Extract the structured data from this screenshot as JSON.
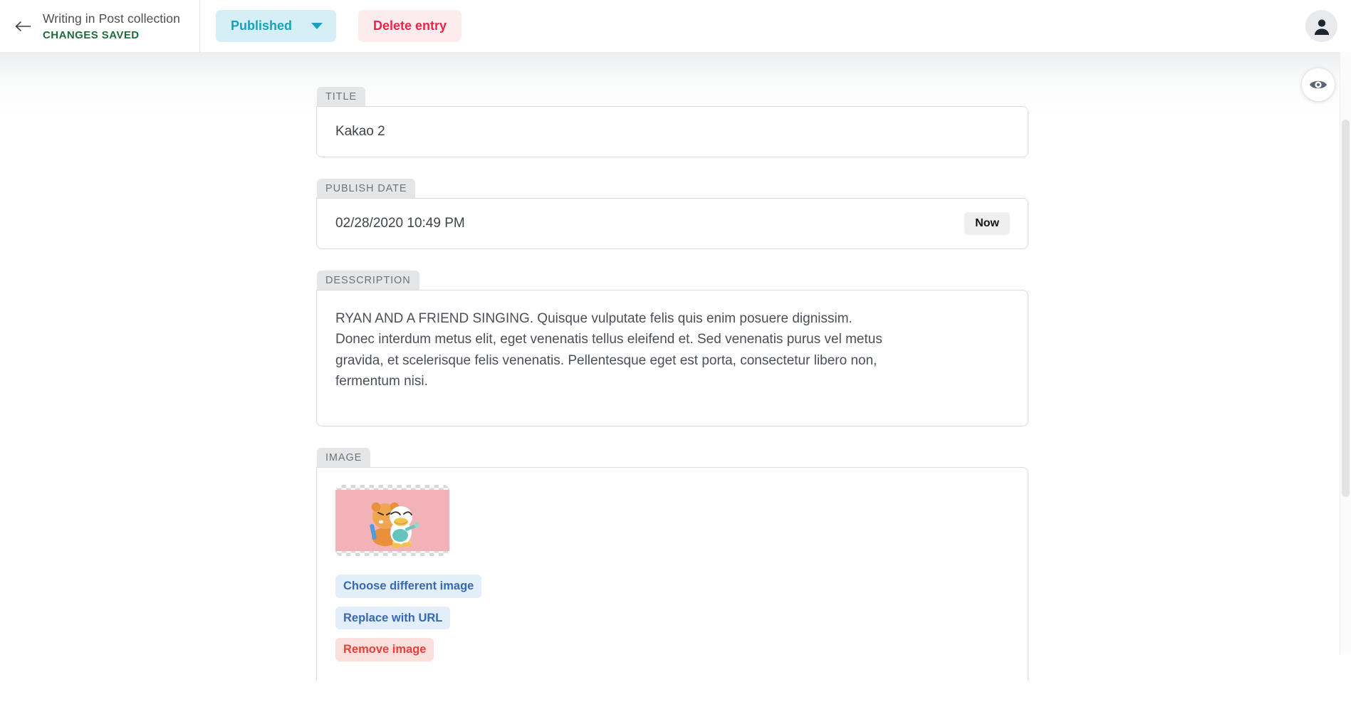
{
  "header": {
    "back_icon": "arrow-left-icon",
    "page_title": "Writing in Post collection",
    "status": "CHANGES SAVED",
    "published_label": "Published",
    "published_caret": "chevron-down-icon",
    "delete_label": "Delete entry",
    "avatar_icon": "user-avatar-icon",
    "accent_published_bg": "#d4eff5",
    "accent_published_text": "#19a0bd",
    "accent_delete_bg": "#fceced",
    "accent_delete_text": "#e8264b",
    "status_color": "#1d6b3c"
  },
  "sidebar": {
    "preview_icon": "eye-icon"
  },
  "form": {
    "fields": [
      {
        "label": "TITLE",
        "value": "Kakao 2"
      },
      {
        "label": "PUBLISH DATE",
        "value": "02/28/2020 10:49 PM",
        "button": "Now"
      },
      {
        "label": "DESSCRIPTION",
        "value": "RYAN AND A FRIEND SINGING. Quisque vulputate felis quis enim posuere dignissim. Donec interdum metus elit, eget venenatis tellus eleifend et. Sed venenatis purus vel metus gravida, et scelerisque felis venenatis. Pellentesque eget est porta, consectetur libero non, fermentum nisi."
      },
      {
        "label": "IMAGE"
      }
    ],
    "title": {
      "label": "TITLE",
      "value": "Kakao 2"
    },
    "publish_date": {
      "label": "PUBLISH DATE",
      "value": "02/28/2020 10:49 PM",
      "now_button": "Now"
    },
    "description": {
      "label": "DESSCRIPTION",
      "value": "RYAN AND A FRIEND SINGING. Quisque vulputate felis quis enim posuere dignissim. Donec interdum metus elit, eget venenatis tellus eleifend et. Sed venenatis purus vel metus gravida, et scelerisque felis venenatis. Pellentesque eget est porta, consectetur libero non, fermentum nisi."
    },
    "image": {
      "label": "IMAGE",
      "thumbnail_alt": "kakao-friends-characters-thumbnail",
      "thumbnail_bg": "#f2b3b8",
      "choose_label": "Choose different image",
      "replace_label": "Replace with URL",
      "remove_label": "Remove image",
      "chip_blue_bg": "#e2effb",
      "chip_blue_text": "#3769b3",
      "chip_red_bg": "#fbdfdc",
      "chip_red_text": "#e8413a"
    }
  }
}
